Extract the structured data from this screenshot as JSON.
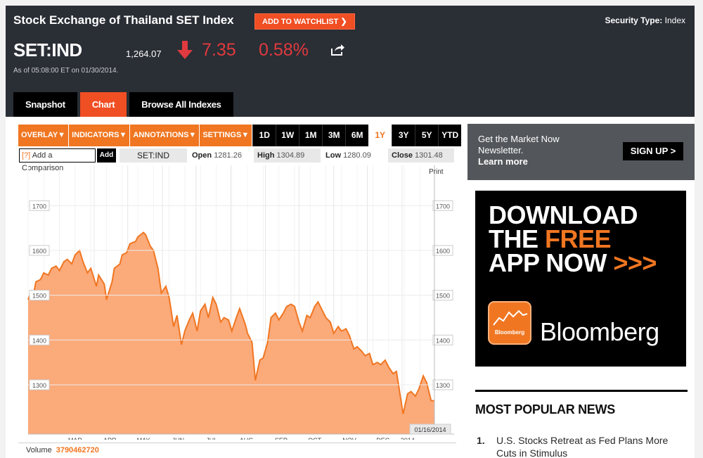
{
  "header": {
    "title": "Stock Exchange of Thailand SET Index",
    "watchlist_label": "ADD TO WATCHLIST",
    "security_type_label": "Security Type:",
    "security_type_value": "Index",
    "ticker": "SET:IND",
    "price": "1,264.07",
    "change": "7.35",
    "change_pct": "0.58%",
    "as_of": "As of 05:08:00 ET on 01/30/2014.",
    "down_color": "#e03a3e"
  },
  "tabs": [
    {
      "label": "Snapshot",
      "active": false
    },
    {
      "label": "Chart",
      "active": true
    },
    {
      "label": "Browse All Indexes",
      "active": false
    }
  ],
  "toolbar": {
    "dropdowns": [
      "OVERLAY",
      "INDICATORS",
      "ANNOTATIONS",
      "SETTINGS"
    ],
    "ranges": [
      "1D",
      "1W",
      "1M",
      "3M",
      "6M",
      "1Y",
      "3Y",
      "5Y",
      "YTD"
    ],
    "active_range": "1Y"
  },
  "compare": {
    "help": "[?]",
    "label": "Add a Comparison",
    "add_label": "Add"
  },
  "quote": {
    "symbol": "SET:IND",
    "open_label": "Open",
    "open": "1281.26",
    "high_label": "High",
    "high": "1304.89",
    "low_label": "Low",
    "low": "1280.09",
    "close_label": "Close",
    "close": "1301.48"
  },
  "chart_data": {
    "type": "area",
    "title": "",
    "xlabel": "",
    "ylabel": "",
    "ylim": [
      1190,
      1790
    ],
    "y_ticks": [
      1300,
      1400,
      1500,
      1600,
      1700
    ],
    "x_tick_labels": [
      "MAR",
      "APR",
      "MAY",
      "JUN",
      "JUL",
      "AUG",
      "SEP",
      "OCT",
      "NOV",
      "DEC",
      "2014"
    ],
    "print_label": "Print",
    "date_label": "01/16/2014",
    "grid": true,
    "color": "#f07621",
    "fill": "#fbaa7a",
    "series": [
      {
        "x": [
          "2013-02-01",
          "2013-02-04",
          "2013-02-06",
          "2013-02-08",
          "2013-02-12",
          "2013-02-15",
          "2013-02-19",
          "2013-02-22",
          "2013-02-26",
          "2013-03-01",
          "2013-03-05",
          "2013-03-08",
          "2013-03-12",
          "2013-03-15",
          "2013-03-19",
          "2013-03-22",
          "2013-03-26",
          "2013-03-29",
          "2013-04-03",
          "2013-04-05",
          "2013-04-10",
          "2013-04-12",
          "2013-04-17",
          "2013-04-19",
          "2013-04-24",
          "2013-04-26",
          "2013-04-30",
          "2013-05-03",
          "2013-05-08",
          "2013-05-10",
          "2013-05-15",
          "2013-05-17",
          "2013-05-21",
          "2013-05-24",
          "2013-05-28",
          "2013-05-31",
          "2013-06-04",
          "2013-06-07",
          "2013-06-11",
          "2013-06-14",
          "2013-06-18",
          "2013-06-21",
          "2013-06-25",
          "2013-06-28",
          "2013-07-02",
          "2013-07-05",
          "2013-07-09",
          "2013-07-12",
          "2013-07-16",
          "2013-07-19",
          "2013-07-23",
          "2013-07-26",
          "2013-07-30",
          "2013-08-02",
          "2013-08-06",
          "2013-08-09",
          "2013-08-14",
          "2013-08-16",
          "2013-08-20",
          "2013-08-23",
          "2013-08-27",
          "2013-08-30",
          "2013-09-03",
          "2013-09-06",
          "2013-09-10",
          "2013-09-13",
          "2013-09-17",
          "2013-09-20",
          "2013-09-24",
          "2013-09-27",
          "2013-10-01",
          "2013-10-04",
          "2013-10-08",
          "2013-10-11",
          "2013-10-15",
          "2013-10-18",
          "2013-10-22",
          "2013-10-25",
          "2013-10-29",
          "2013-11-01",
          "2013-11-05",
          "2013-11-08",
          "2013-11-12",
          "2013-11-15",
          "2013-11-19",
          "2013-11-22",
          "2013-11-26",
          "2013-11-29",
          "2013-12-03",
          "2013-12-06",
          "2013-12-10",
          "2013-12-13",
          "2013-12-17",
          "2013-12-20",
          "2013-12-24",
          "2013-12-27",
          "2014-01-02",
          "2014-01-06",
          "2014-01-09",
          "2014-01-13",
          "2014-01-16",
          "2014-01-20",
          "2014-01-23",
          "2014-01-27",
          "2014-01-30"
        ],
        "values": [
          1490,
          1510,
          1505,
          1530,
          1535,
          1550,
          1545,
          1560,
          1565,
          1555,
          1575,
          1580,
          1570,
          1590,
          1600,
          1575,
          1550,
          1560,
          1520,
          1545,
          1525,
          1490,
          1530,
          1560,
          1570,
          1590,
          1595,
          1615,
          1620,
          1630,
          1640,
          1635,
          1610,
          1600,
          1560,
          1505,
          1520,
          1495,
          1430,
          1455,
          1390,
          1420,
          1445,
          1460,
          1420,
          1465,
          1480,
          1450,
          1495,
          1480,
          1440,
          1450,
          1445,
          1420,
          1450,
          1470,
          1435,
          1415,
          1395,
          1310,
          1355,
          1360,
          1395,
          1450,
          1460,
          1445,
          1460,
          1475,
          1480,
          1475,
          1440,
          1420,
          1455,
          1450,
          1475,
          1485,
          1465,
          1450,
          1440,
          1415,
          1430,
          1420,
          1425,
          1410,
          1380,
          1385,
          1375,
          1365,
          1370,
          1345,
          1350,
          1345,
          1355,
          1340,
          1325,
          1330,
          1235,
          1280,
          1285,
          1275,
          1290,
          1320,
          1305,
          1265,
          1264
        ]
      }
    ]
  },
  "volume": {
    "label": "Volume",
    "value": "3790462720"
  },
  "newsletter": {
    "line1": "Get the Market Now",
    "line2": "Newsletter.",
    "learn_more": "Learn more",
    "signup_label": "SIGN UP >"
  },
  "ad": {
    "line1": "DOWNLOAD",
    "line2a": "THE ",
    "line2b": "FREE",
    "line3a": "APP NOW ",
    "line3b": ">>>",
    "icon_label": "Bloomberg",
    "brand": "Bloomberg"
  },
  "most_popular": {
    "title": "MOST POPULAR NEWS",
    "items": [
      {
        "num": "1.",
        "text": "U.S. Stocks Retreat as Fed Plans More Cuts in Stimulus"
      }
    ]
  }
}
